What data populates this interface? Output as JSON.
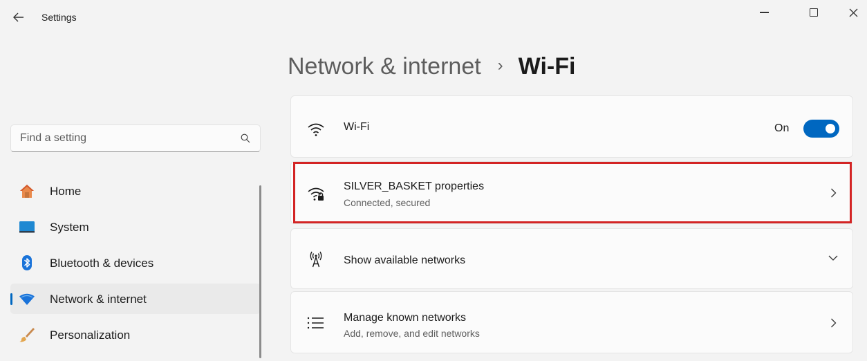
{
  "titlebar": {
    "app_title": "Settings",
    "back_icon": "arrow-left-icon",
    "controls": [
      "minimize-icon",
      "maximize-icon",
      "close-icon"
    ]
  },
  "search": {
    "placeholder": "Find a setting",
    "value": "",
    "icon": "search-icon"
  },
  "sidebar": {
    "items": [
      {
        "label": "Home",
        "icon": "home-icon",
        "active": false
      },
      {
        "label": "System",
        "icon": "monitor-icon",
        "active": false
      },
      {
        "label": "Bluetooth & devices",
        "icon": "bluetooth-icon",
        "active": false
      },
      {
        "label": "Network & internet",
        "icon": "wifi-diamond-icon",
        "active": true
      },
      {
        "label": "Personalization",
        "icon": "paintbrush-icon",
        "active": false
      }
    ]
  },
  "header": {
    "parent": "Network & internet",
    "separator": "›",
    "current": "Wi-Fi"
  },
  "cards": {
    "wifi": {
      "title": "Wi-Fi",
      "toggle_label": "On",
      "toggle_on": true,
      "icon": "wifi-icon"
    },
    "properties": {
      "title": "SILVER_BASKET properties",
      "subtitle": "Connected, secured",
      "icon": "wifi-lock-icon",
      "chevron": "chevron-right-icon",
      "highlighted": true
    },
    "available": {
      "title": "Show available networks",
      "icon": "antenna-icon",
      "chevron": "chevron-down-icon"
    },
    "known": {
      "title": "Manage known networks",
      "subtitle": "Add, remove, and edit networks",
      "icon": "list-icon",
      "chevron": "chevron-right-icon"
    }
  },
  "colors": {
    "accent": "#0067c0",
    "highlight_border": "#d32424",
    "background": "#f3f3f3",
    "card": "#fbfbfb"
  }
}
